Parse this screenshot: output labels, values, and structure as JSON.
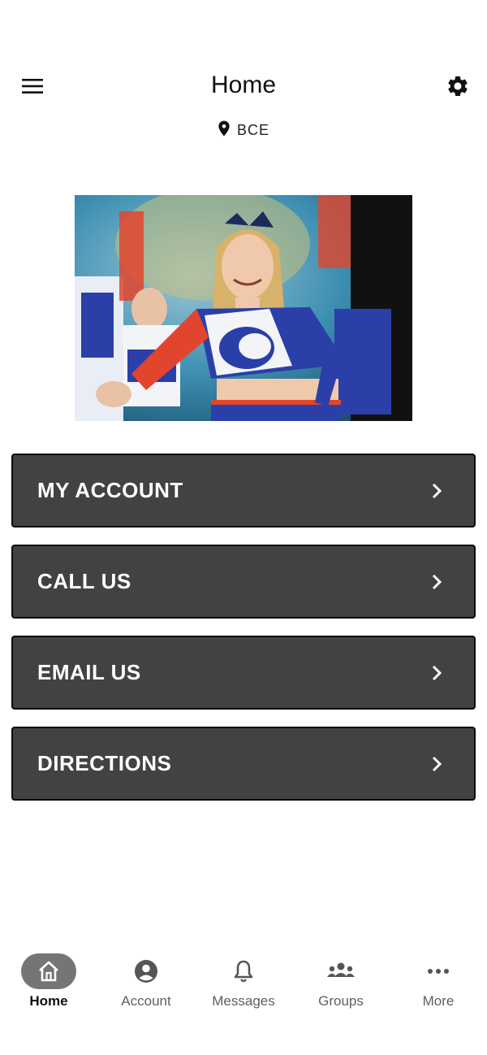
{
  "header": {
    "title": "Home",
    "menu_icon": "hamburger-menu-icon",
    "settings_icon": "gear-icon"
  },
  "location": {
    "icon": "location-pin-icon",
    "label": "BCE"
  },
  "hero_image": {
    "subject": "cheerleader photo"
  },
  "actions": [
    {
      "label": "MY ACCOUNT",
      "icon": "chevron-right-icon"
    },
    {
      "label": "CALL US",
      "icon": "chevron-right-icon"
    },
    {
      "label": "EMAIL US",
      "icon": "chevron-right-icon"
    },
    {
      "label": "DIRECTIONS",
      "icon": "chevron-right-icon"
    }
  ],
  "bottom_nav": [
    {
      "label": "Home",
      "icon": "home-icon",
      "active": true
    },
    {
      "label": "Account",
      "icon": "account-circle-icon",
      "active": false
    },
    {
      "label": "Messages",
      "icon": "bell-icon",
      "active": false
    },
    {
      "label": "Groups",
      "icon": "groups-icon",
      "active": false
    },
    {
      "label": "More",
      "icon": "more-dots-icon",
      "active": false
    }
  ],
  "colors": {
    "button_bg": "#424242",
    "button_border": "#0a0a0a",
    "active_nav_pill": "#757575",
    "nav_text": "#5f5f5f"
  }
}
